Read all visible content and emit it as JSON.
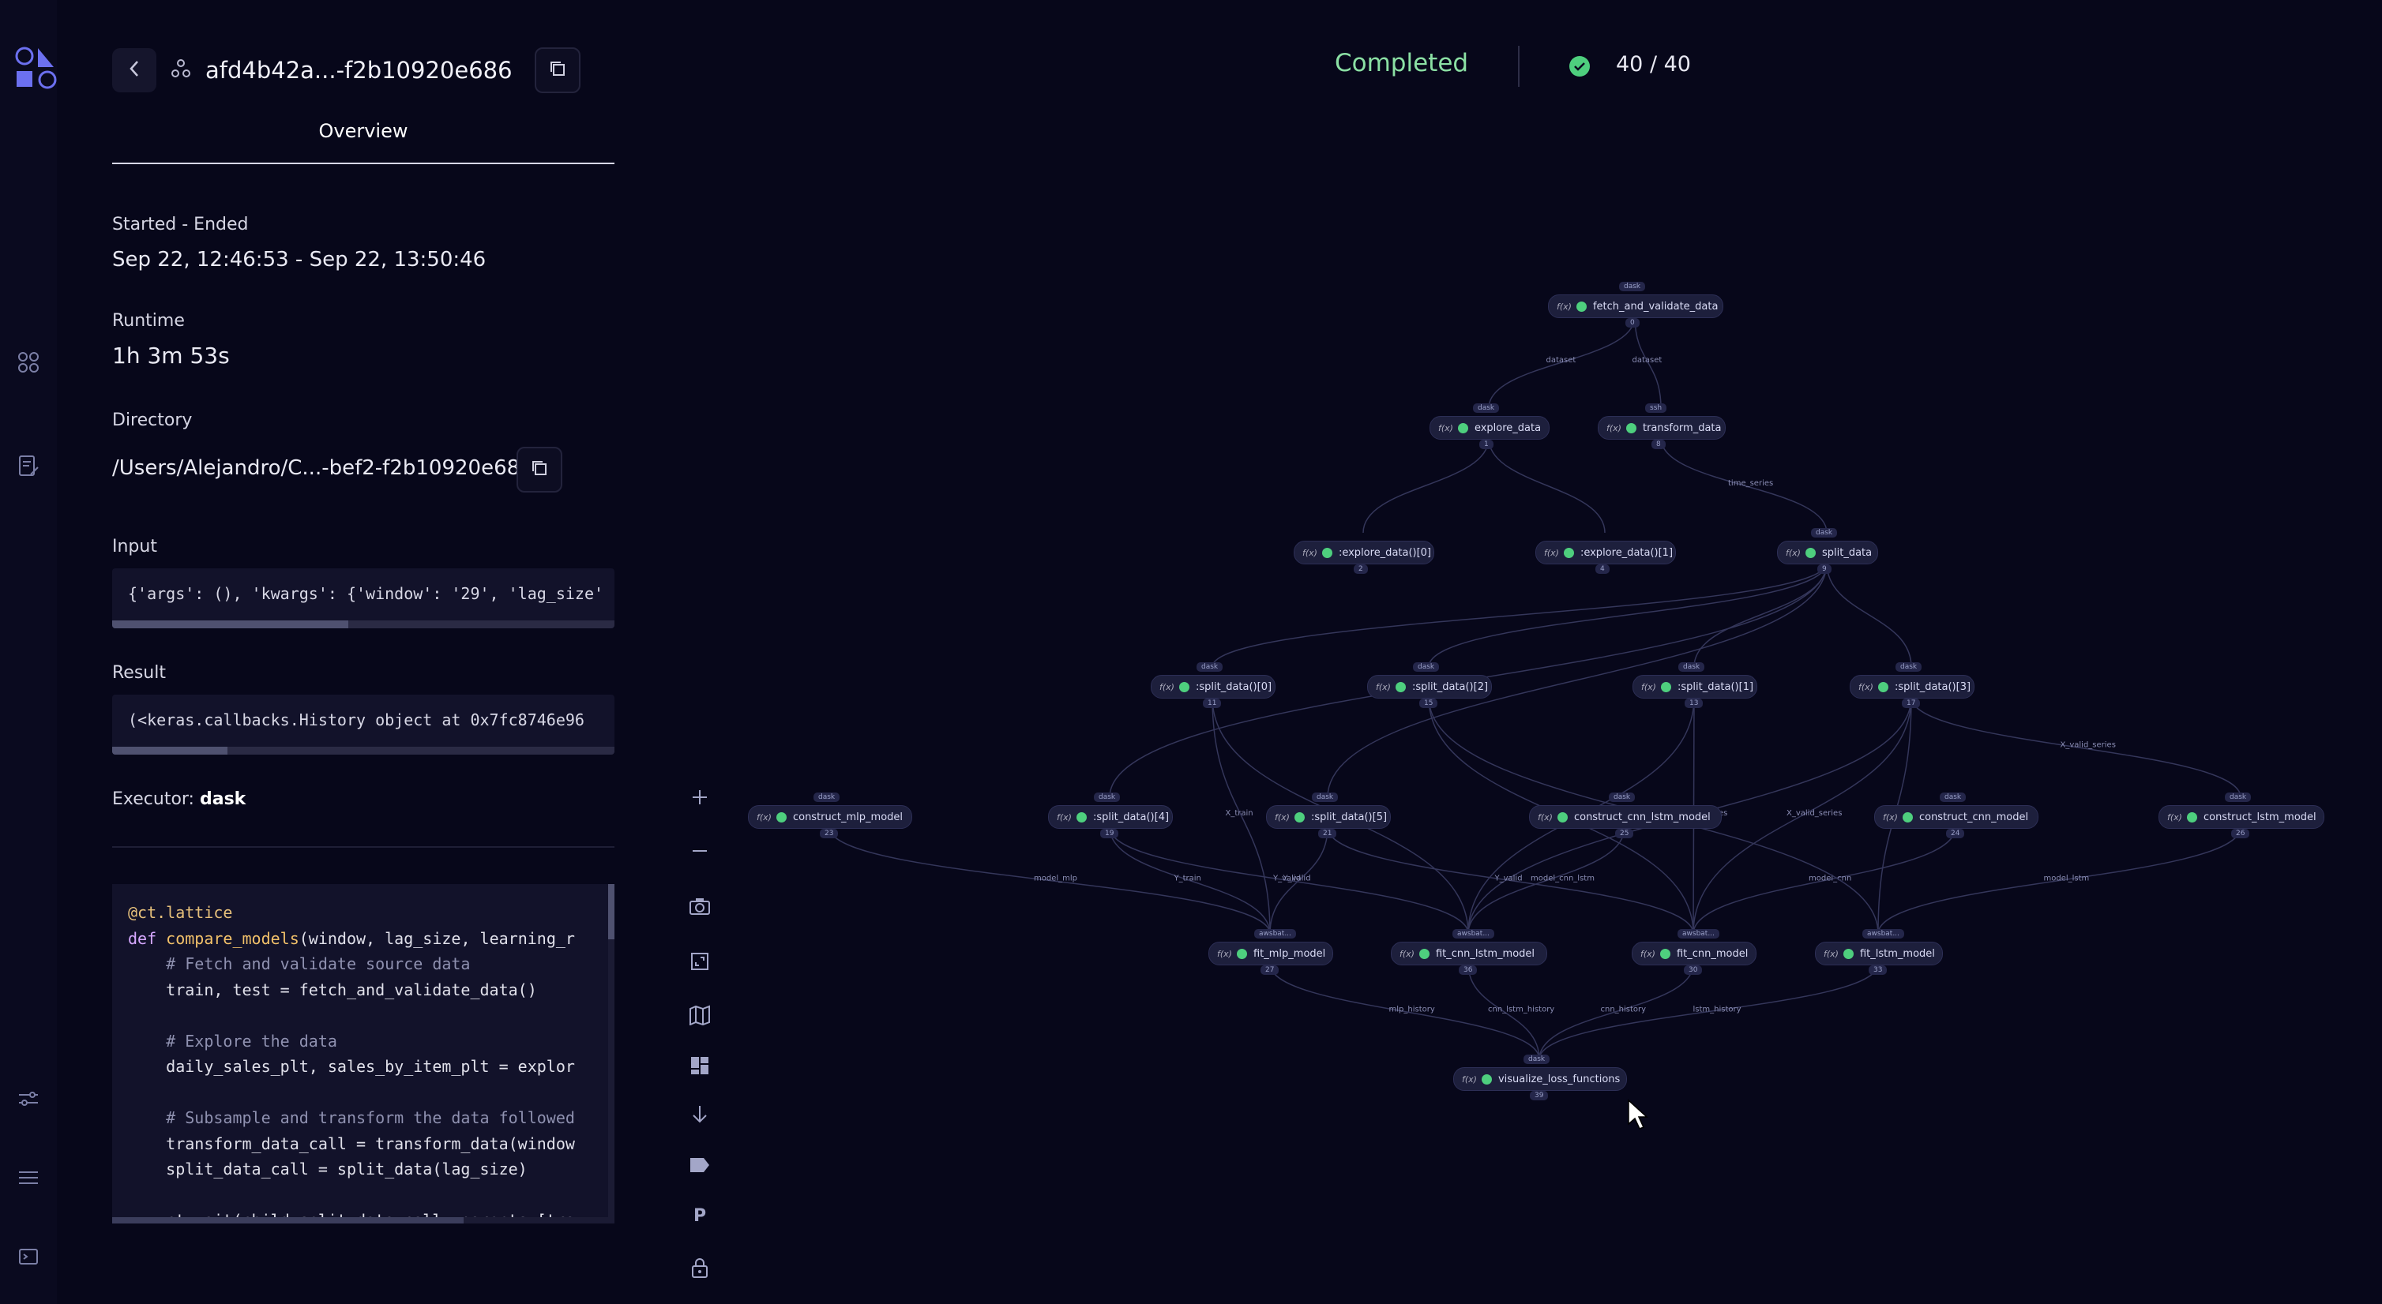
{
  "header": {
    "dispatch_id": "afd4b42a...-f2b10920e686",
    "tab_label": "Overview"
  },
  "status": {
    "label": "Completed",
    "count": "40 / 40"
  },
  "overview": {
    "started_label": "Started - Ended",
    "started_value": "Sep 22, 12:46:53 - Sep 22, 13:50:46",
    "runtime_label": "Runtime",
    "runtime_value": "1h 3m 53s",
    "directory_label": "Directory",
    "directory_value": "/Users/Alejandro/C...-bef2-f2b10920e686",
    "input_label": "Input",
    "input_value": "{'args': (), 'kwargs': {'window': '29', 'lag_size'",
    "input_scroll_fraction": 0.47,
    "result_label": "Result",
    "result_value": "(<keras.callbacks.History object at 0x7fc8746e96",
    "result_scroll_fraction": 0.23,
    "executor_label": "Executor:",
    "executor_value": "dask"
  },
  "source_code": [
    "@ct.lattice",
    "def compare_models(window, lag_size, learning_r",
    "    # Fetch and validate source data",
    "    train, test = fetch_and_validate_data()",
    "",
    "    # Explore the data",
    "    daily_sales_plt, sales_by_item_plt = explor",
    "",
    "    # Subsample and transform the data followed",
    "    transform_data_call = transform_data(window",
    "    split_data_call = split_data(lag_size)",
    "",
    "    ct.wait(child=split_data_call, parents=[tra"
  ],
  "toolbar": {
    "fit_view_label": "P"
  },
  "graph": {
    "nodes": [
      {
        "key": "n0",
        "label": "fetch_and_validate_data",
        "tag": "dask",
        "id": "0"
      },
      {
        "key": "n1",
        "label": "explore_data",
        "tag": "dask",
        "id": "1"
      },
      {
        "key": "n2",
        "label": "transform_data",
        "tag": "ssh",
        "id": "8"
      },
      {
        "key": "n3",
        "label": ":explore_data()[0]",
        "tag": "",
        "id": "2"
      },
      {
        "key": "n4",
        "label": ":explore_data()[1]",
        "tag": "",
        "id": "4"
      },
      {
        "key": "n5",
        "label": "split_data",
        "tag": "dask",
        "id": "9"
      },
      {
        "key": "n6",
        "label": ":split_data()[0]",
        "tag": "dask",
        "id": "11"
      },
      {
        "key": "n7",
        "label": ":split_data()[2]",
        "tag": "dask",
        "id": "15"
      },
      {
        "key": "n8",
        "label": ":split_data()[1]",
        "tag": "dask",
        "id": "13"
      },
      {
        "key": "n9",
        "label": ":split_data()[3]",
        "tag": "dask",
        "id": "17"
      },
      {
        "key": "n10",
        "label": "construct_mlp_model",
        "tag": "dask",
        "id": "23"
      },
      {
        "key": "n11",
        "label": ":split_data()[4]",
        "tag": "dask",
        "id": "19"
      },
      {
        "key": "n12",
        "label": ":split_data()[5]",
        "tag": "dask",
        "id": "21"
      },
      {
        "key": "n13",
        "label": "construct_cnn_lstm_model",
        "tag": "dask",
        "id": "25"
      },
      {
        "key": "n14",
        "label": "construct_cnn_model",
        "tag": "dask",
        "id": "24"
      },
      {
        "key": "n15",
        "label": "construct_lstm_model",
        "tag": "dask",
        "id": "26"
      },
      {
        "key": "n16",
        "label": "fit_mlp_model",
        "tag": "awsbat...",
        "id": "27"
      },
      {
        "key": "n17",
        "label": "fit_cnn_lstm_model",
        "tag": "awsbat...",
        "id": "36"
      },
      {
        "key": "n18",
        "label": "fit_cnn_model",
        "tag": "awsbat...",
        "id": "30"
      },
      {
        "key": "n19",
        "label": "fit_lstm_model",
        "tag": "awsbat...",
        "id": "33"
      },
      {
        "key": "n20",
        "label": "visualize_loss_functions",
        "tag": "dask",
        "id": "39"
      }
    ],
    "edge_labels": [
      "dataset",
      "dataset",
      "time_series",
      "X_train",
      "X_train_series",
      "X_valid_series",
      "_train_series",
      "X_valid_series",
      "_series",
      "X_valid_series",
      "model_mlp",
      "Y_train",
      "Y_valid",
      "Y_valid",
      "model_cnn_lstm",
      "Y_valid",
      "model_cnn",
      "model_lstm",
      "mlp_history",
      "cnn_lstm_history",
      "cnn_history",
      "lstm_history"
    ]
  },
  "colors": {
    "success": "#4ecf7e",
    "status_text": "#8be0a4",
    "accent": "#6366f1"
  }
}
